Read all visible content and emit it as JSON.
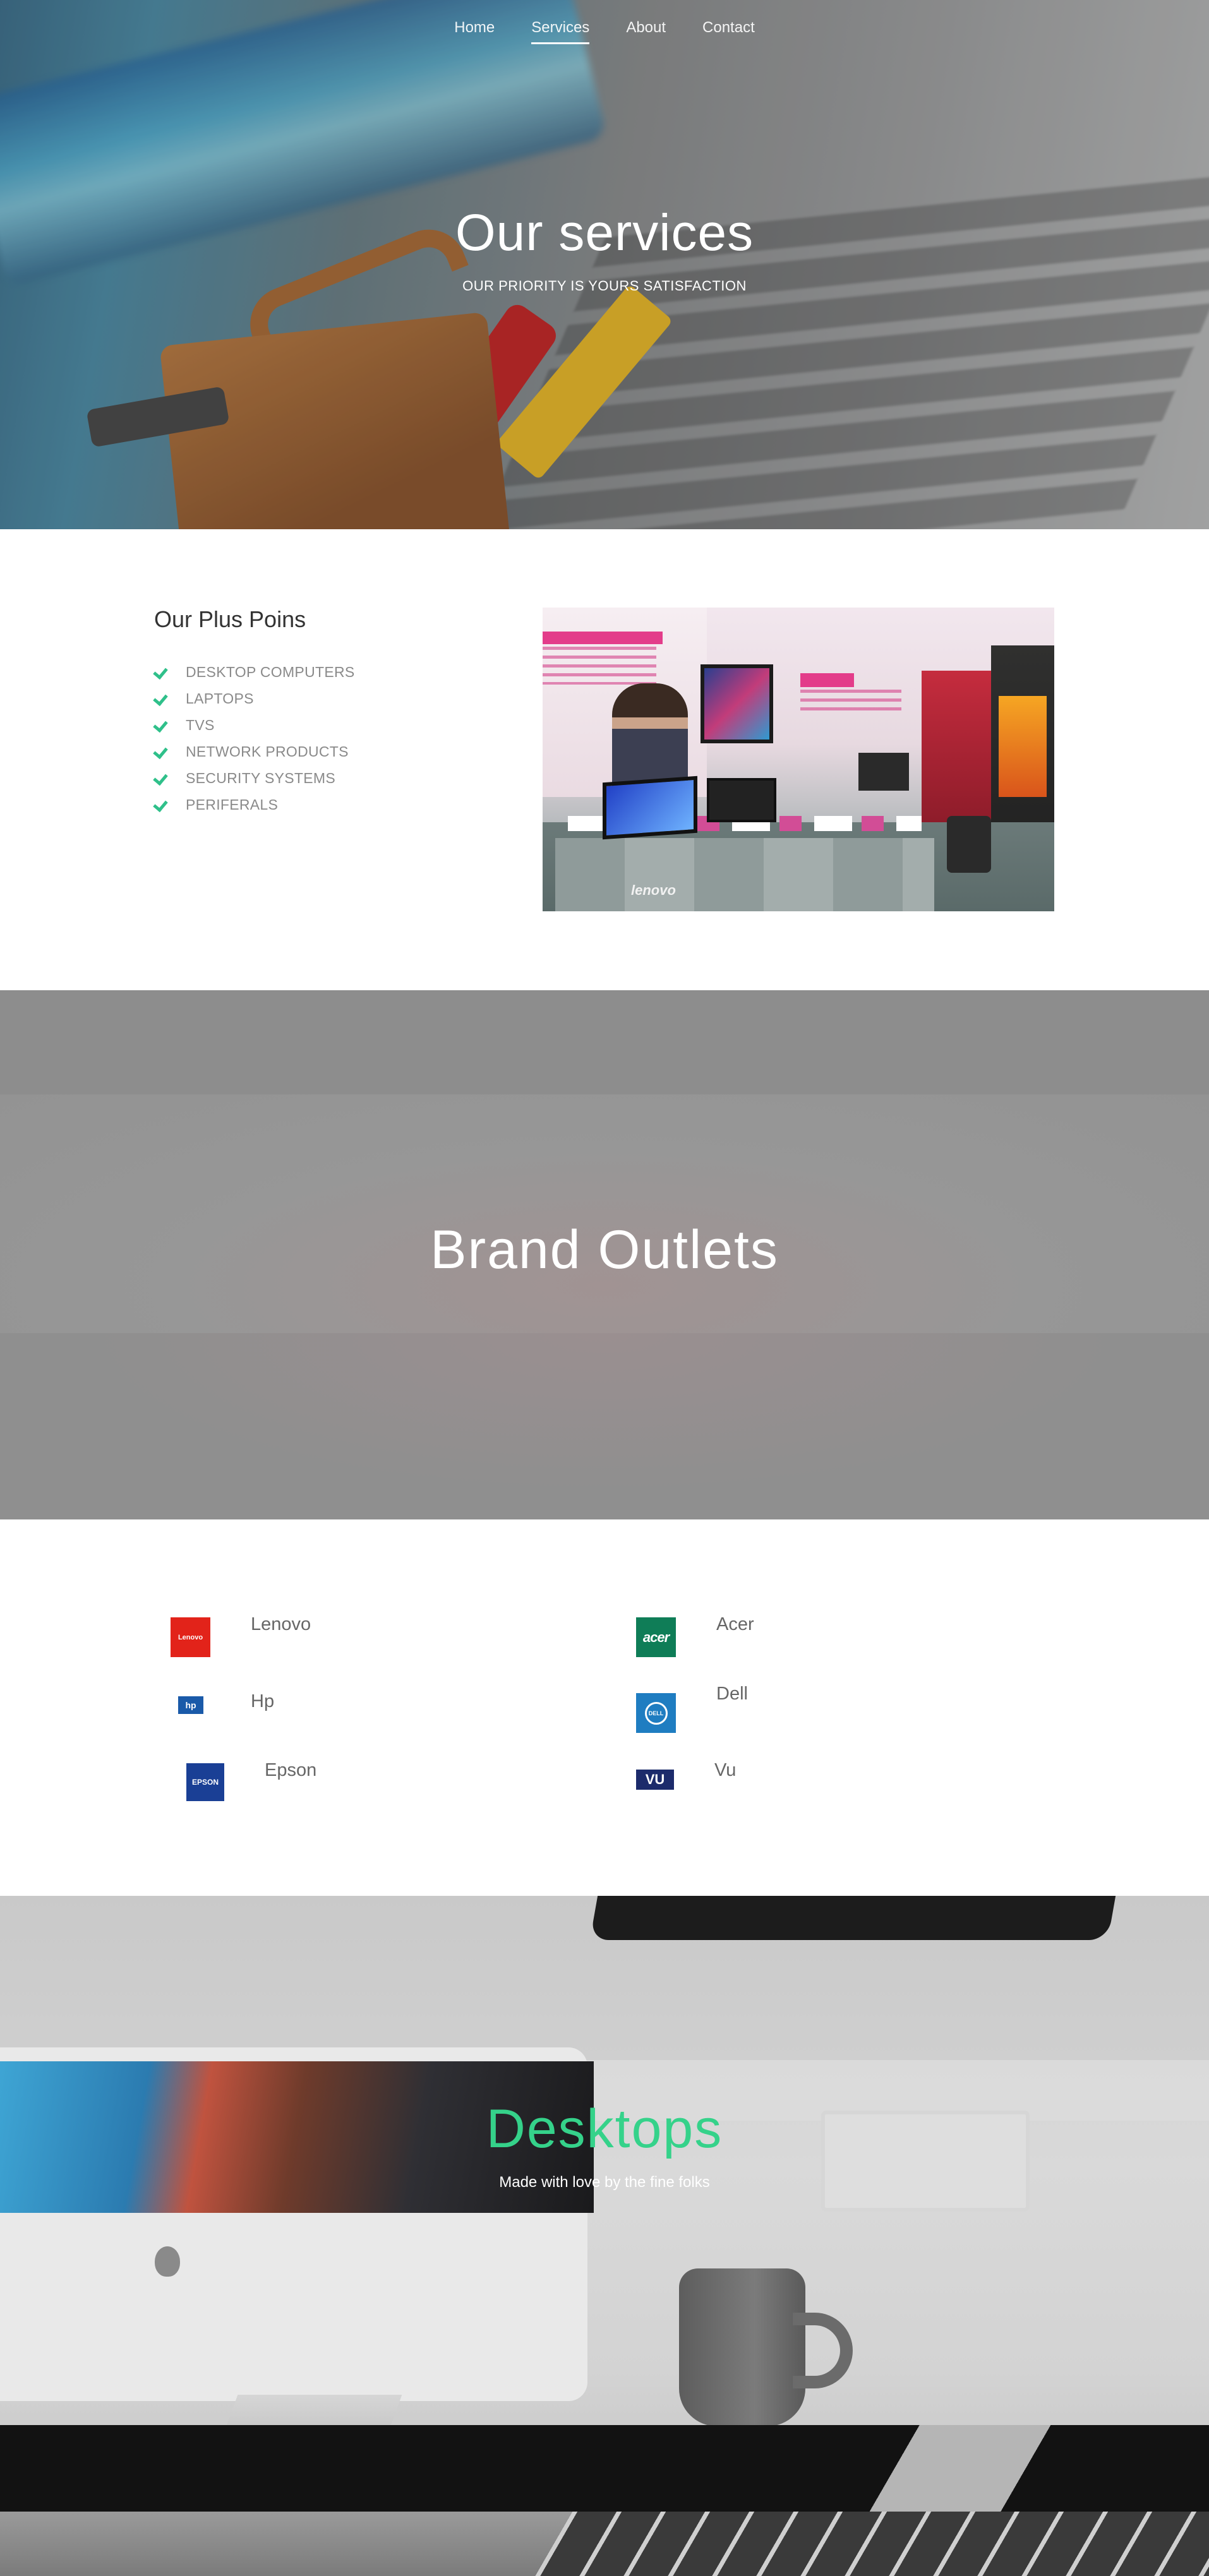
{
  "nav": {
    "items": [
      {
        "label": "Home",
        "active": false
      },
      {
        "label": "Services",
        "active": true
      },
      {
        "label": "About",
        "active": false
      },
      {
        "label": "Contact",
        "active": false
      }
    ]
  },
  "hero": {
    "title": "Our services",
    "subtitle": "OUR PRIORITY IS YOURS SATISFACTION"
  },
  "plus_points": {
    "title": "Our Plus Poins",
    "items": [
      "DESKTOP COMPUTERS",
      "LAPTOPS",
      "TVS",
      "NETWORK PRODUCTS",
      "SECURITY SYSTEMS",
      "PERIFERALS"
    ],
    "check_icon": "check-icon",
    "store_image_brand_text": "lenovo"
  },
  "brand_outlets": {
    "title": "Brand Outlets"
  },
  "brands": [
    {
      "name": "Lenovo",
      "logo_text": "Lenovo",
      "logo_color": "#e2231a"
    },
    {
      "name": "Acer",
      "logo_text": "acer",
      "logo_color": "#0f7d57"
    },
    {
      "name": "Hp",
      "logo_text": "hp",
      "logo_color": "#1a5aa9"
    },
    {
      "name": "Dell",
      "logo_text": "DELL",
      "logo_color": "#1f7dc1"
    },
    {
      "name": "Epson",
      "logo_text": "EPSON",
      "logo_color": "#1a3f95"
    },
    {
      "name": "Vu",
      "logo_text": "VU",
      "logo_color": "#1c2b6b"
    }
  ],
  "desktops": {
    "title": "Desktops",
    "subtitle": "Made with love by the fine folks"
  },
  "colors": {
    "accent_green": "#2fc08a",
    "desktops_title": "#35d28a"
  }
}
